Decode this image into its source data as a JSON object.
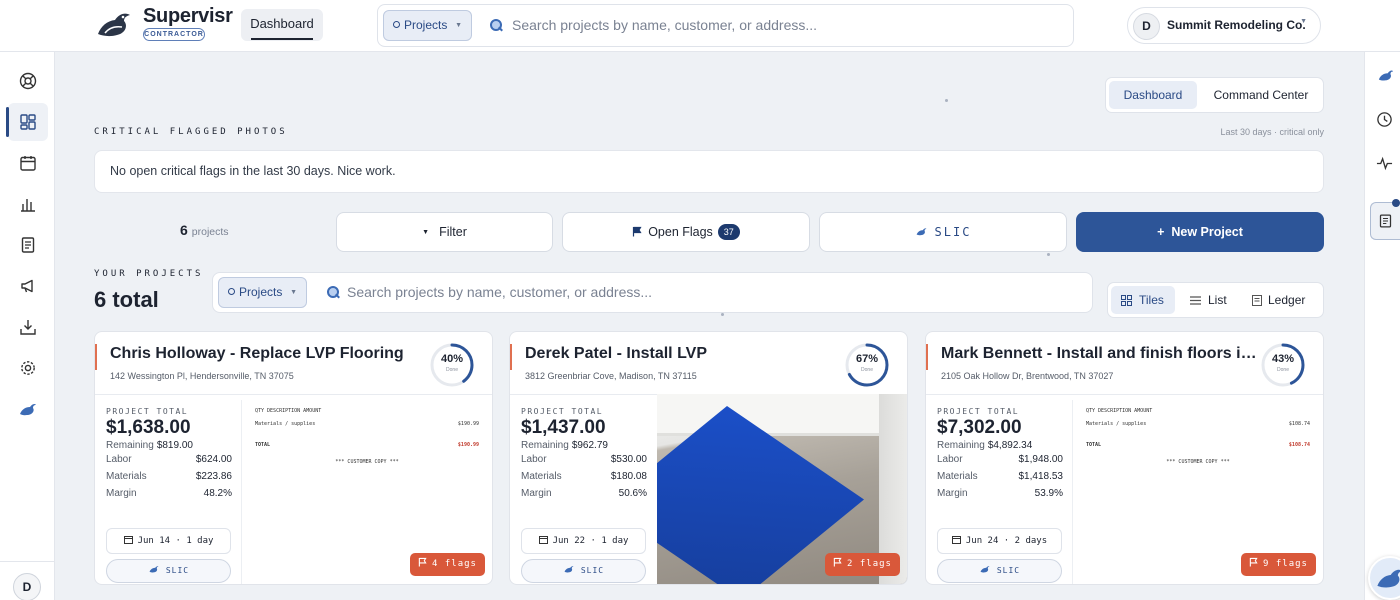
{
  "app": {
    "name": "Supervisr",
    "badge": "CONTRACTOR",
    "top_tab": "Dashboard",
    "search_scope": "Projects",
    "search_placeholder": "Search projects by name, customer, or address...",
    "company_initial": "D",
    "company_name": "Summit Remodeling Co.",
    "user_initial": "D"
  },
  "view_toggle": {
    "active": "Dashboard",
    "other": "Command Center"
  },
  "flagged": {
    "heading": "CRITICAL FLAGGED PHOTOS",
    "hint": "Last 30 days · critical only",
    "empty_message": "No open critical flags in the last 30 days. Nice work."
  },
  "toolbar": {
    "count": "6",
    "count_suffix": "projects",
    "filter_label": "Filter",
    "open_flags_label": "Open Flags",
    "open_flags_count": "37",
    "slic_label": "SLIC",
    "new_project_label": "New Project"
  },
  "projects": {
    "heading": "YOUR PROJECTS",
    "total": "6 total",
    "search_scope": "Projects",
    "search_placeholder": "Search projects by name, customer, or address...",
    "views": [
      "Tiles",
      "List",
      "Ledger"
    ]
  },
  "cards": [
    {
      "title": "Chris Holloway - Replace LVP Flooring",
      "address": "142 Wessington Pl, Hendersonville, TN 37075",
      "percent": "40%",
      "percent_value": 40,
      "done_label": "Done",
      "total_label": "PROJECT TOTAL",
      "total": "$1,638.00",
      "remaining_label": "Remaining",
      "remaining": "$819.00",
      "labor": "$624.00",
      "materials": "$223.86",
      "margin": "48.2%",
      "date": "Jun 14 · 1 day",
      "flags": "4 flags",
      "slic": "SLIC",
      "receipt": {
        "header": "QTY DESCRIPTION AMOUNT",
        "line": "Materials / supplies",
        "line_amount": "$190.99",
        "total_label": "TOTAL",
        "total_amount": "$190.99",
        "footer": "*** CUSTOMER COPY ***"
      }
    },
    {
      "title": "Derek Patel - Install LVP",
      "address": "3812 Greenbriar Cove, Madison, TN 37115",
      "percent": "67%",
      "percent_value": 67,
      "done_label": "Done",
      "total_label": "PROJECT TOTAL",
      "total": "$1,437.00",
      "remaining_label": "Remaining",
      "remaining": "$962.79",
      "labor": "$530.00",
      "materials": "$180.08",
      "margin": "50.6%",
      "date": "Jun 22 · 1 day",
      "flags": "2 flags",
      "slic": "SLIC"
    },
    {
      "title": "Mark Bennett - Install and finish floors in…",
      "address": "2105 Oak Hollow Dr, Brentwood, TN 37027",
      "percent": "43%",
      "percent_value": 43,
      "done_label": "Done",
      "total_label": "PROJECT TOTAL",
      "total": "$7,302.00",
      "remaining_label": "Remaining",
      "remaining": "$4,892.34",
      "labor": "$1,948.00",
      "materials": "$1,418.53",
      "margin": "53.9%",
      "date": "Jun 24 · 2 days",
      "flags": "9 flags",
      "slic": "SLIC",
      "receipt": {
        "header": "QTY DESCRIPTION AMOUNT",
        "line": "Materials / supplies",
        "line_amount": "$108.74",
        "total_label": "TOTAL",
        "total_amount": "$108.74",
        "footer": "*** CUSTOMER COPY ***"
      }
    }
  ],
  "labels": {
    "labor": "Labor",
    "materials": "Materials",
    "margin": "Margin"
  },
  "colors": {
    "brand": "#2d5598",
    "flag": "#d9583a",
    "accent": "#e07050"
  }
}
